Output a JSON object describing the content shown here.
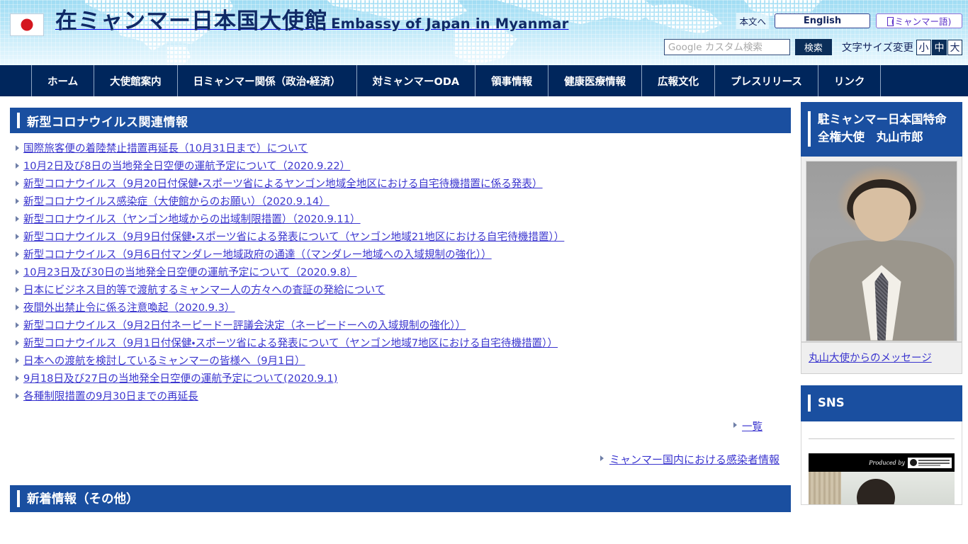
{
  "header": {
    "flag_icon": "japan-flag-icon",
    "title_ja": "在ミャンマー日本国大使館",
    "title_en": "Embassy of Japan in Myanmar",
    "skip_link": "本文へ",
    "lang_english": "English",
    "lang_myanmar": "မြန်မာ(ミャンマー語)",
    "lang_myanmar_fallback": "(ミャンマー語)",
    "search": {
      "placeholder": "Google カスタム検索",
      "value": "",
      "button_label": "検索"
    },
    "fontsize": {
      "label": "文字サイズ変更",
      "options": [
        "小",
        "中",
        "大"
      ],
      "selected": "中"
    }
  },
  "gnav": {
    "items": [
      {
        "label": "ホーム"
      },
      {
        "label": "大使館案内"
      },
      {
        "label": "日ミャンマー関係（政治・経済）"
      },
      {
        "label": "対ミャンマーODA"
      },
      {
        "label": "領事情報"
      },
      {
        "label": "健康医療情報"
      },
      {
        "label": "広報文化"
      },
      {
        "label": "プレスリリース"
      },
      {
        "label": "リンク"
      }
    ]
  },
  "main": {
    "covid_section_title": "新型コロナウイルス関連情報",
    "covid_links": [
      {
        "label": "国際旅客便の着陸禁止措置再延長（10月31日まで）について"
      },
      {
        "label": "10月2日及び8日の当地発全日空便の運航予定について（2020.9.22）"
      },
      {
        "label": "新型コロナウイルス（9月20日付保健・スポーツ省によるヤンゴン地域全地区における自宅待機措置に係る発表）"
      },
      {
        "label": "新型コロナウイルス感染症（大使館からのお願い）（2020.9.14）"
      },
      {
        "label": "新型コロナウイルス（ヤンゴン地域からの出域制限措置）（2020.9.11）"
      },
      {
        "label": "新型コロナウイルス（9月9日付保健・スポーツ省による発表について（ヤンゴン地域21地区における自宅待機措置））"
      },
      {
        "label": "新型コロナウイルス（9月6日付マンダレー地域政府の通達（（マンダレー地域への入域規制の強化））"
      },
      {
        "label": "10月23日及び30日の当地発全日空便の運航予定について（2020.9.8）"
      },
      {
        "label": "日本にビジネス目的等で渡航するミャンマー人の方々への査証の発給について"
      },
      {
        "label": "夜間外出禁止令に係る注意喚起（2020.9.3）"
      },
      {
        "label": "新型コロナウイルス（9月2日付ネーピードー評議会決定（ネーピードーへの入域規制の強化））"
      },
      {
        "label": "新型コロナウイルス（9月1日付保健・スポーツ省による発表について（ヤンゴン地域7地区における自宅待機措置））"
      },
      {
        "label": "日本への渡航を検討しているミャンマーの皆様へ（9月1日）"
      },
      {
        "label": "9月18日及び27日の当地発全日空便の運航予定について(2020.9.1)"
      },
      {
        "label": "各種制限措置の9月30日までの再延長"
      }
    ],
    "all_link": "一覧",
    "infection_link": "ミャンマー国内における感染者情報",
    "other_news_title": "新着情報（その他）"
  },
  "sidebar": {
    "ambassador": {
      "title": "駐ミャンマー日本国特命全権大使　丸山市郎",
      "photo_alt": "ambassador-portrait",
      "message_link": "丸山大使からのメッセージ"
    },
    "sns": {
      "title": "SNS",
      "video_credit": "Produced by",
      "video_logo_alt": "producer-logo"
    }
  },
  "colors": {
    "brand_navy": "#00265c",
    "section_blue": "#1a4fa0",
    "link_purple": "#3b36cf",
    "header_blue": "#9fdcf3",
    "flag_red": "#d4171f"
  }
}
